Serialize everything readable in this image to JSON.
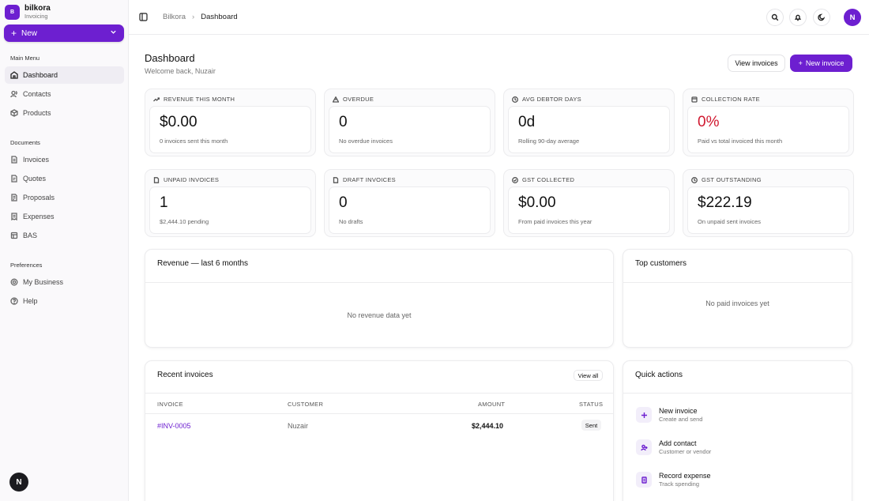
{
  "brand": {
    "logo_letter": "B",
    "name": "bilkora",
    "sub": "Invoicing"
  },
  "sidebar": {
    "new_label": "New",
    "sections": {
      "main": "Main Menu",
      "documents": "Documents",
      "preferences": "Preferences"
    },
    "items": [
      {
        "label": "Dashboard",
        "icon": "dashboard-icon"
      },
      {
        "label": "Contacts",
        "icon": "contacts-icon"
      },
      {
        "label": "Products",
        "icon": "products-icon"
      },
      {
        "label": "Invoices",
        "icon": "invoices-icon"
      },
      {
        "label": "Quotes",
        "icon": "quotes-icon"
      },
      {
        "label": "Proposals",
        "icon": "proposals-icon"
      },
      {
        "label": "Expenses",
        "icon": "expenses-icon"
      },
      {
        "label": "BAS",
        "icon": "bas-icon"
      },
      {
        "label": "My Business",
        "icon": "business-icon"
      },
      {
        "label": "Help",
        "icon": "help-icon"
      }
    ],
    "footer_avatar": "N"
  },
  "topbar": {
    "breadcrumb": [
      "Bilkora",
      "Dashboard"
    ],
    "user_initial": "N"
  },
  "page": {
    "title": "Dashboard",
    "subtitle": "Welcome back, Nuzair",
    "view_invoices": "View invoices",
    "new_invoice": "New invoice"
  },
  "stats": [
    {
      "label": "REVENUE THIS MONTH",
      "value": "$0.00",
      "desc": "0 invoices sent this month"
    },
    {
      "label": "OVERDUE",
      "value": "0",
      "desc": "No overdue invoices"
    },
    {
      "label": "AVG DEBTOR DAYS",
      "value": "0d",
      "desc": "Rolling 90-day average"
    },
    {
      "label": "COLLECTION RATE",
      "value": "0%",
      "desc": "Paid vs total invoiced this month",
      "color": "#d0182f"
    },
    {
      "label": "UNPAID INVOICES",
      "value": "1",
      "desc": "$2,444.10 pending"
    },
    {
      "label": "DRAFT INVOICES",
      "value": "0",
      "desc": "No drafts"
    },
    {
      "label": "GST COLLECTED",
      "value": "$0.00",
      "desc": "From paid invoices this year"
    },
    {
      "label": "GST OUTSTANDING",
      "value": "$222.19",
      "desc": "On unpaid sent invoices"
    }
  ],
  "revenue": {
    "title": "Revenue — last 6 months",
    "empty": "No revenue data yet"
  },
  "top_customers": {
    "title": "Top customers",
    "empty": "No paid invoices yet"
  },
  "recent": {
    "title": "Recent invoices",
    "view_all": "View all",
    "columns": [
      "INVOICE",
      "CUSTOMER",
      "AMOUNT",
      "STATUS"
    ],
    "rows": [
      {
        "invoice": "#INV-0005",
        "customer": "Nuzair",
        "amount": "$2,444.10",
        "status": "Sent"
      }
    ]
  },
  "quick_actions": {
    "title": "Quick actions",
    "items": [
      {
        "title": "New invoice",
        "sub": "Create and send",
        "icon": "plus-icon"
      },
      {
        "title": "Add contact",
        "sub": "Customer or vendor",
        "icon": "user-plus-icon"
      },
      {
        "title": "Record expense",
        "sub": "Track spending",
        "icon": "receipt-icon"
      }
    ]
  },
  "colors": {
    "accent": "#6d1fd0",
    "danger": "#d0182f"
  }
}
